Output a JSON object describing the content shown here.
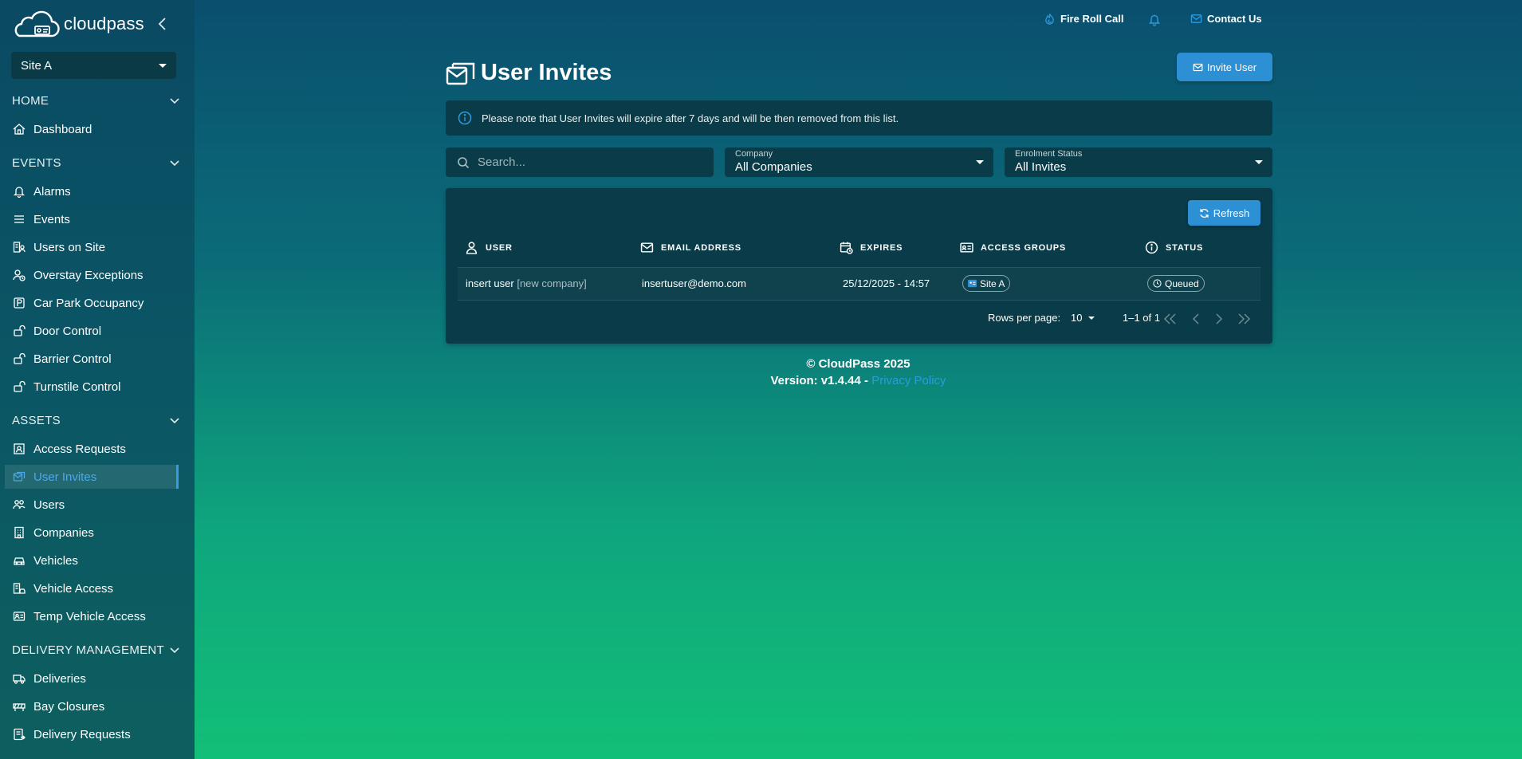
{
  "brand": {
    "name": "cloudpass"
  },
  "site_selector": {
    "value": "Site A"
  },
  "sidebar": {
    "sections": [
      {
        "title": "HOME",
        "items": [
          {
            "label": "Dashboard",
            "icon": "home-icon"
          }
        ]
      },
      {
        "title": "EVENTS",
        "items": [
          {
            "label": "Alarms",
            "icon": "bell-icon"
          },
          {
            "label": "Events",
            "icon": "list-icon"
          },
          {
            "label": "Users on Site",
            "icon": "building-user-icon"
          },
          {
            "label": "Overstay Exceptions",
            "icon": "clock-user-icon"
          },
          {
            "label": "Car Park Occupancy",
            "icon": "parking-icon"
          },
          {
            "label": "Door Control",
            "icon": "door-icon"
          },
          {
            "label": "Barrier Control",
            "icon": "barrier-icon"
          },
          {
            "label": "Turnstile Control",
            "icon": "turnstile-icon"
          }
        ]
      },
      {
        "title": "ASSETS",
        "items": [
          {
            "label": "Access Requests",
            "icon": "access-request-icon"
          },
          {
            "label": "User Invites",
            "icon": "envelope-icon",
            "active": true
          },
          {
            "label": "Users",
            "icon": "users-icon"
          },
          {
            "label": "Companies",
            "icon": "company-icon"
          },
          {
            "label": "Vehicles",
            "icon": "car-icon"
          },
          {
            "label": "Vehicle Access",
            "icon": "vehicle-access-icon"
          },
          {
            "label": "Temp Vehicle Access",
            "icon": "temp-vehicle-icon"
          }
        ]
      },
      {
        "title": "DELIVERY MANAGEMENT",
        "items": [
          {
            "label": "Deliveries",
            "icon": "truck-icon"
          },
          {
            "label": "Bay Closures",
            "icon": "bay-closure-icon"
          },
          {
            "label": "Delivery Requests",
            "icon": "delivery-request-icon"
          }
        ]
      }
    ]
  },
  "topbar": {
    "fire_roll_call": "Fire Roll Call",
    "contact_us": "Contact Us"
  },
  "page": {
    "title": "User Invites",
    "invite_button": "Invite User",
    "notice": "Please note that User Invites will expire after 7 days and will be then removed from this list."
  },
  "filters": {
    "search_placeholder": "Search...",
    "company": {
      "label": "Company",
      "value": "All Companies"
    },
    "enrolment": {
      "label": "Enrolment Status",
      "value": "All Invites"
    }
  },
  "table": {
    "refresh_label": "Refresh",
    "columns": [
      "USER",
      "EMAIL ADDRESS",
      "EXPIRES",
      "ACCESS GROUPS",
      "STATUS"
    ],
    "rows": [
      {
        "user": "insert user",
        "company": "[new company]",
        "email": "insertuser@demo.com",
        "expires": "25/12/2025 - 14:57",
        "access_group": "Site A",
        "status": "Queued"
      }
    ],
    "pagination": {
      "rows_per_page_label": "Rows per page:",
      "rows_per_page": "10",
      "range": "1–1 of 1"
    }
  },
  "footer": {
    "copyright": "© CloudPass 2025",
    "version": "Version: v1.4.44 - ",
    "privacy": "Privacy Policy"
  },
  "colors": {
    "accent": "#2d8fd4",
    "active_nav": "#4aa8e8",
    "panel": "#093c48"
  }
}
